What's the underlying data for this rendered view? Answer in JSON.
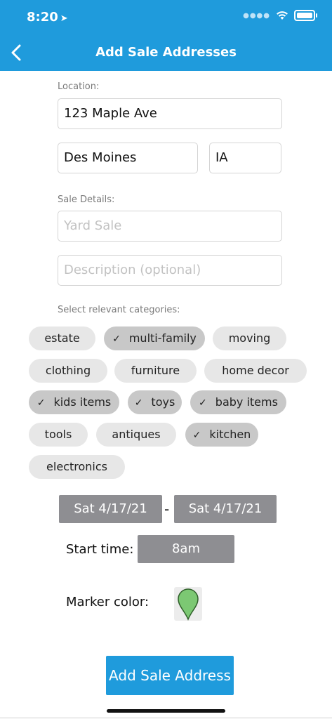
{
  "status": {
    "time": "8:20",
    "location_arrow": "➤"
  },
  "nav": {
    "title": "Add Sale Addresses"
  },
  "form": {
    "location_label": "Location:",
    "street": "123 Maple Ave",
    "city": "Des Moines",
    "state": "IA",
    "details_label": "Sale Details:",
    "title_placeholder": "Yard Sale",
    "description_placeholder": "Description (optional)",
    "categories_label": "Select relevant categories:"
  },
  "categories": [
    {
      "label": "estate",
      "selected": false
    },
    {
      "label": "multi-family",
      "selected": true
    },
    {
      "label": "moving",
      "selected": false
    },
    {
      "label": "clothing",
      "selected": false
    },
    {
      "label": "furniture",
      "selected": false
    },
    {
      "label": "home decor",
      "selected": false
    },
    {
      "label": "kids items",
      "selected": true
    },
    {
      "label": "toys",
      "selected": true
    },
    {
      "label": "baby items",
      "selected": true
    },
    {
      "label": "tools",
      "selected": false
    },
    {
      "label": "antiques",
      "selected": false
    },
    {
      "label": "kitchen",
      "selected": true
    },
    {
      "label": "electronics",
      "selected": false
    }
  ],
  "check_glyph": "✓",
  "dates": {
    "start": "Sat 4/17/21",
    "separator": "-",
    "end": "Sat 4/17/21"
  },
  "start_time": {
    "label": "Start time:",
    "value": "8am"
  },
  "marker": {
    "label": "Marker color:",
    "color": "#7cc873"
  },
  "submit_label": "Add Sale Address",
  "colors": {
    "accent": "#1f9bdc",
    "chip": "#e7e7e7",
    "chip_selected": "#c8c8c8",
    "button_gray": "#8e8e92"
  }
}
